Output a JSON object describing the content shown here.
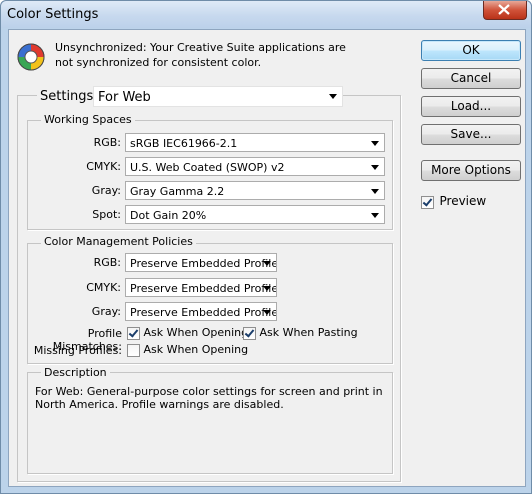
{
  "window": {
    "title": "Color Settings"
  },
  "sync": {
    "message": "Unsynchronized: Your Creative Suite applications are not synchronized for consistent color."
  },
  "buttons": {
    "ok": "OK",
    "cancel": "Cancel",
    "load": "Load...",
    "save": "Save...",
    "more_options": "More Options"
  },
  "preview": {
    "label": "Preview",
    "checked": true
  },
  "settings": {
    "label": "Settings:",
    "value": "For Web"
  },
  "working_spaces": {
    "title": "Working Spaces",
    "rgb": {
      "label": "RGB:",
      "value": "sRGB IEC61966-2.1"
    },
    "cmyk": {
      "label": "CMYK:",
      "value": "U.S. Web Coated (SWOP) v2"
    },
    "gray": {
      "label": "Gray:",
      "value": "Gray Gamma 2.2"
    },
    "spot": {
      "label": "Spot:",
      "value": "Dot Gain 20%"
    }
  },
  "policies": {
    "title": "Color Management Policies",
    "rgb": {
      "label": "RGB:",
      "value": "Preserve Embedded Profiles"
    },
    "cmyk": {
      "label": "CMYK:",
      "value": "Preserve Embedded Profiles"
    },
    "gray": {
      "label": "Gray:",
      "value": "Preserve Embedded Profiles"
    },
    "profile_mismatches": {
      "label": "Profile Mismatches:",
      "ask_opening": "Ask When Opening",
      "ask_opening_checked": true,
      "ask_pasting": "Ask When Pasting",
      "ask_pasting_checked": true
    },
    "missing_profiles": {
      "label": "Missing Profiles:",
      "ask_opening": "Ask When Opening",
      "ask_opening_checked": false
    }
  },
  "description": {
    "title": "Description",
    "text": "For Web:  General-purpose color settings for screen and print in North America. Profile warnings are disabled."
  }
}
